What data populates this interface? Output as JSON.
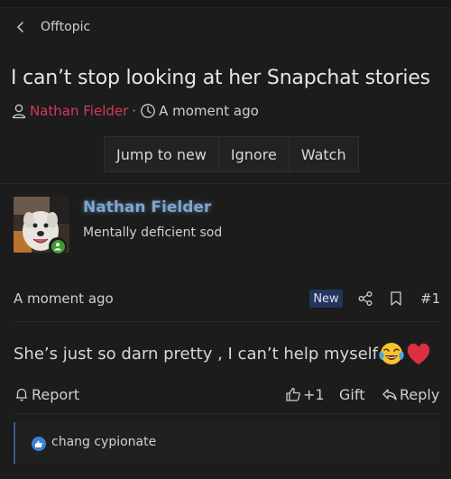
{
  "breadcrumb": {
    "label": "Offtopic"
  },
  "thread": {
    "title": "I can’t stop looking at her Snapchat stories",
    "author": "Nathan Fielder",
    "separator": "·",
    "time": "A moment ago"
  },
  "actions": {
    "jump": "Jump to new",
    "ignore": "Ignore",
    "watch": "Watch"
  },
  "post": {
    "username": "Nathan Fielder",
    "rank": "Mentally deficient sod",
    "time": "A moment ago",
    "badge": "New",
    "number": "#1",
    "body": "She’s just so darn pretty , I can’t help myself",
    "emojis": [
      "face-with-tears-of-joy",
      "red-heart"
    ]
  },
  "footer": {
    "report": "Report",
    "like_count": "+1",
    "gift": "Gift",
    "reply": "Reply"
  },
  "reactions": {
    "icon": "like-icon",
    "names": "chang cypionate"
  },
  "colors": {
    "background": "#1c1c1c",
    "author_link": "#d23a59",
    "username": "#7da6cf",
    "online": "#3e9b34",
    "new_badge": "#24355c",
    "reaction_accent": "#3a5a8c"
  }
}
